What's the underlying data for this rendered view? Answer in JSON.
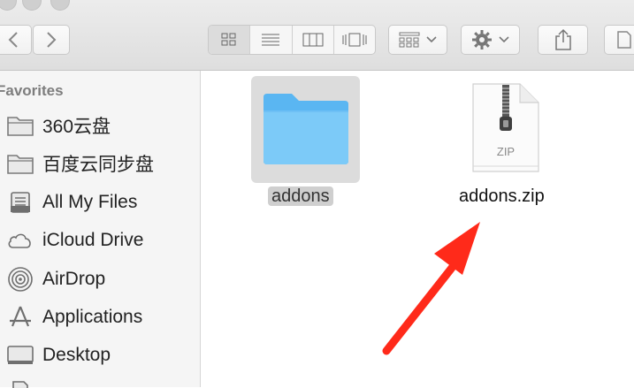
{
  "toolbar": {
    "nav": [
      "back-icon",
      "forward-icon"
    ],
    "view_modes": [
      "icon-view-icon",
      "list-view-icon",
      "column-view-icon",
      "cover-flow-icon"
    ],
    "arrange_icon": "arrange-icon",
    "action_icon": "gear-icon",
    "share_icon": "share-icon"
  },
  "sidebar": {
    "heading": "Favorites",
    "items": [
      {
        "label": "360云盘",
        "icon": "folder-icon"
      },
      {
        "label": "百度云同步盘",
        "icon": "folder-icon"
      },
      {
        "label": "All My Files",
        "icon": "all-files-icon"
      },
      {
        "label": "iCloud Drive",
        "icon": "cloud-icon"
      },
      {
        "label": "AirDrop",
        "icon": "airdrop-icon"
      },
      {
        "label": "Applications",
        "icon": "applications-icon"
      },
      {
        "label": "Desktop",
        "icon": "desktop-icon"
      }
    ]
  },
  "files": [
    {
      "name": "addons",
      "kind": "folder",
      "selected": true
    },
    {
      "name": "addons.zip",
      "kind": "zip",
      "badge": "ZIP",
      "selected": false
    }
  ],
  "annotation": {
    "color": "#ff2a1a",
    "icon": "red-arrow"
  }
}
